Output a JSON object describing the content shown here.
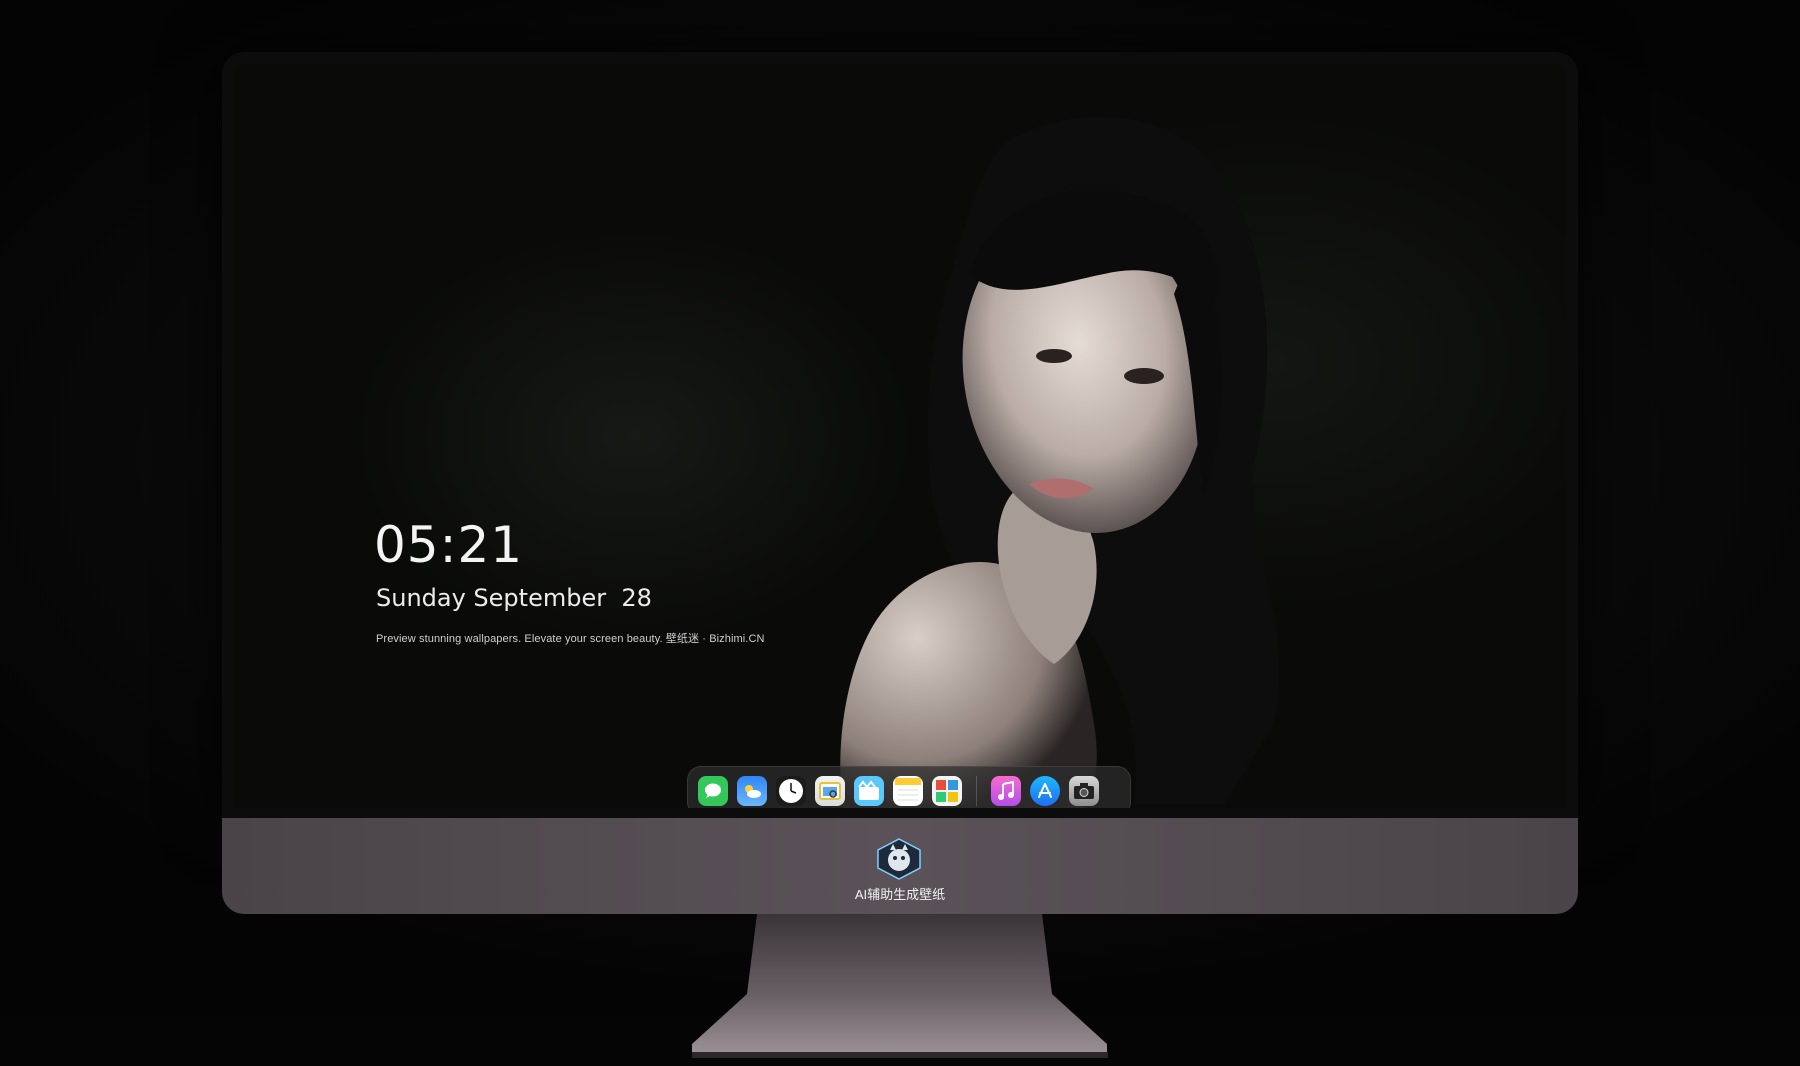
{
  "lockscreen": {
    "time": "05:21",
    "date": "Sunday September  28",
    "tagline": "Preview stunning wallpapers. Elevate your screen beauty. 壁纸迷 · Bizhimi.CN"
  },
  "dock": {
    "apps": [
      {
        "icon": "messages-icon",
        "color": "#34c759"
      },
      {
        "icon": "weather-icon",
        "color": "#2f86f6"
      },
      {
        "icon": "clock-icon",
        "color": "#ffffff"
      },
      {
        "icon": "preview-icon",
        "color": "#e8c23a"
      },
      {
        "icon": "clips-icon",
        "color": "#5ac8fa"
      },
      {
        "icon": "notes-icon",
        "color": "#ffcc33"
      },
      {
        "icon": "photo-booth-icon",
        "color": "#e74c3c"
      },
      {
        "icon": "music-icon",
        "color": "#e84fc6"
      },
      {
        "icon": "app-store-icon",
        "color": "#1e90ff"
      },
      {
        "icon": "camera-icon",
        "color": "#9a9a9a"
      }
    ]
  },
  "brand": {
    "label": "AI辅助生成壁纸"
  },
  "colors": {
    "chin": "#544d52",
    "background": "#050505"
  }
}
